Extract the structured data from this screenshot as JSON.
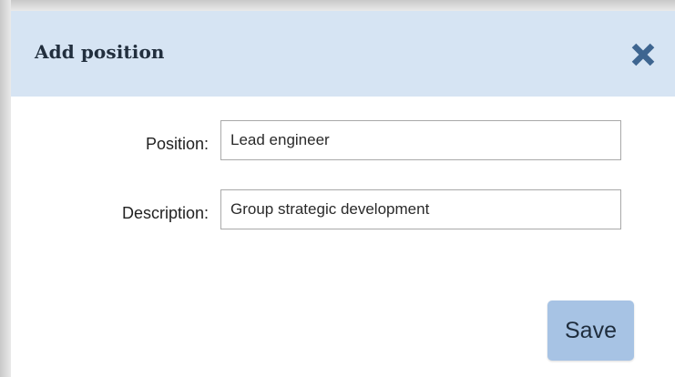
{
  "dialog": {
    "title": "Add position",
    "close_icon": "close-icon",
    "fields": [
      {
        "label": "Position:",
        "value": "Lead engineer"
      },
      {
        "label": "Description:",
        "value": "Group strategic development"
      }
    ],
    "save_label": "Save"
  },
  "colors": {
    "header_background": "#d6e4f3",
    "title_text": "#222f3e",
    "close_icon": "#3e6590",
    "save_button": "#a7c3e4",
    "input_border": "#a9a9a9"
  }
}
